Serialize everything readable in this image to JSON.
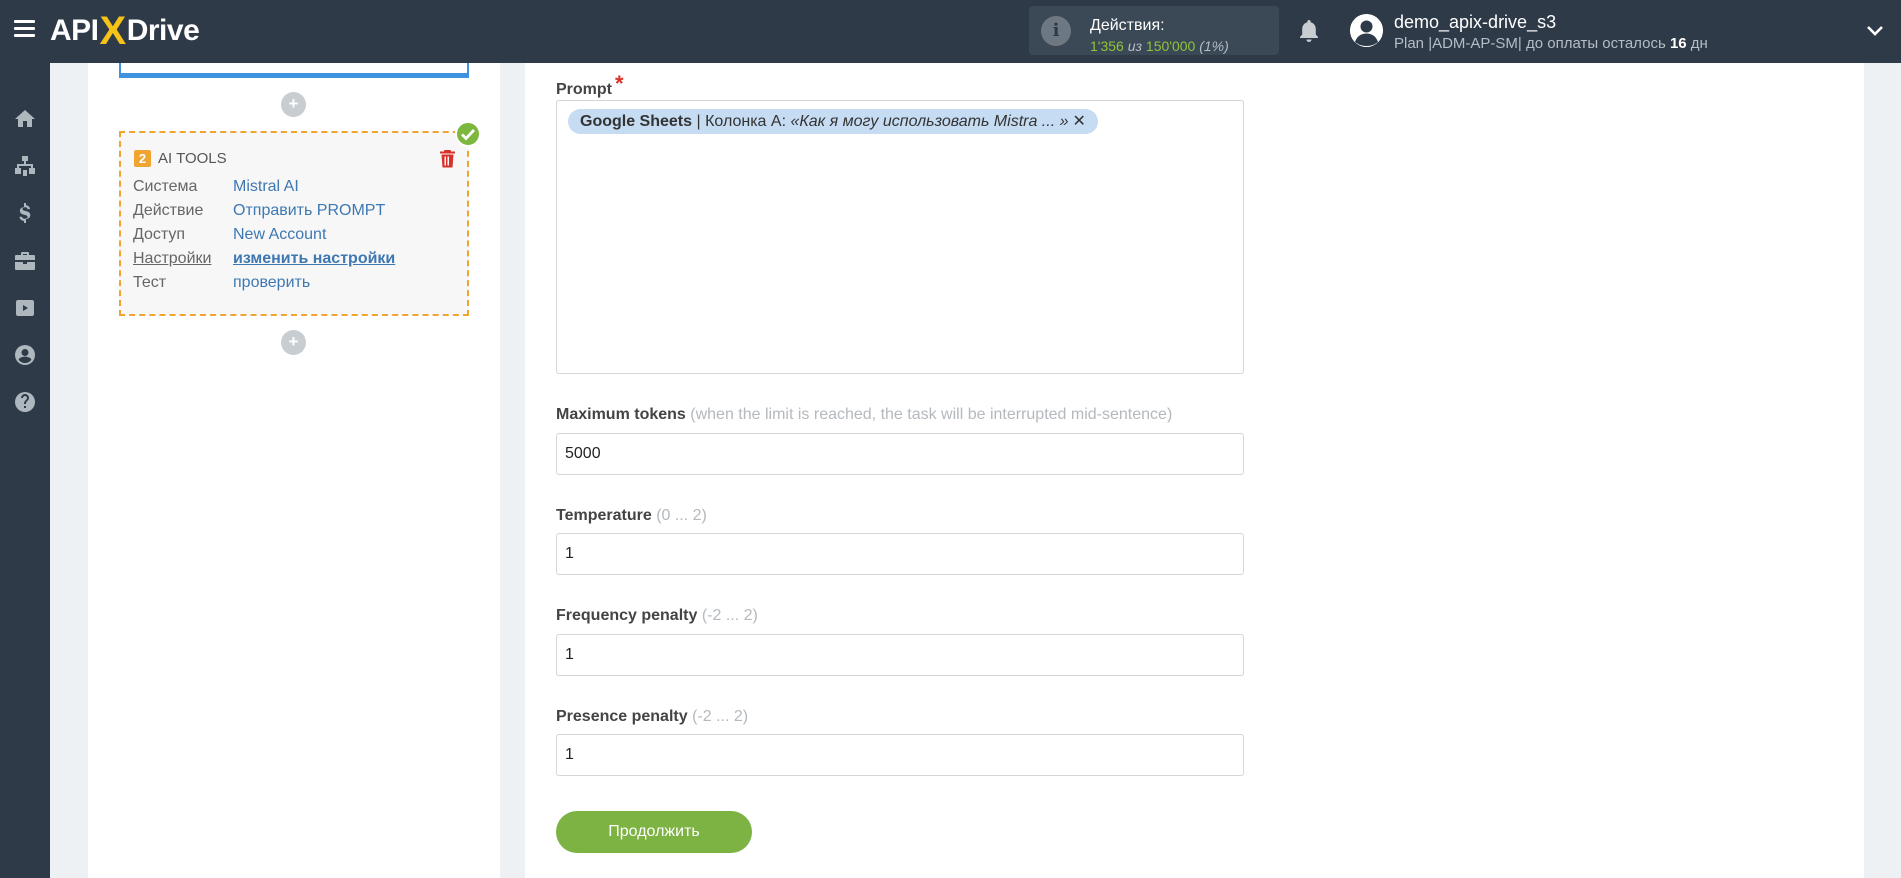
{
  "topbar": {
    "logo_api": "API",
    "logo_x": "X",
    "logo_drive": "Drive",
    "actions_label": "Действия:",
    "actions_used": "1'356",
    "actions_of": "из",
    "actions_total": "150'000",
    "actions_pct": "(1%)",
    "username": "demo_apix-drive_s3",
    "plan_text": "Plan |ADM-AP-SM| до оплаты осталось",
    "plan_days": "16",
    "plan_unit": "дн"
  },
  "sidebar": {
    "items": [
      "home-icon",
      "sitemap-icon",
      "dollar-icon",
      "briefcase-icon",
      "youtube-icon",
      "user-icon",
      "help-icon"
    ]
  },
  "ai_card": {
    "number": "2",
    "title": "AI TOOLS",
    "rows": [
      {
        "key": "Система",
        "value": "Mistral AI"
      },
      {
        "key": "Действие",
        "value": "Отправить PROMPT"
      },
      {
        "key": "Доступ",
        "value": "New Account"
      },
      {
        "key": "Настройки",
        "value": "изменить настройки"
      },
      {
        "key": "Тест",
        "value": "проверить"
      }
    ]
  },
  "form": {
    "prompt_label": "Prompt",
    "prompt_required": "*",
    "prompt_tag": {
      "source": "Google Sheets",
      "column": " | Колонка А: ",
      "text": "«Как я могу использовать Mistra ... »",
      "remove": "✕"
    },
    "max_tokens_label": "Maximum tokens",
    "max_tokens_hint": "(when the limit is reached, the task will be interrupted mid-sentence)",
    "max_tokens_value": "5000",
    "temperature_label": "Temperature",
    "temperature_hint": "(0 ... 2)",
    "temperature_value": "1",
    "frequency_label": "Frequency penalty",
    "frequency_hint": "(-2 ... 2)",
    "frequency_value": "1",
    "presence_label": "Presence penalty",
    "presence_hint": "(-2 ... 2)",
    "presence_value": "1",
    "continue_label": "Продолжить"
  },
  "colors": {
    "topbar": "#2e3a47",
    "accent_green": "#7cb342",
    "card_border": "#f0a530",
    "link_blue": "#3e78b2"
  }
}
